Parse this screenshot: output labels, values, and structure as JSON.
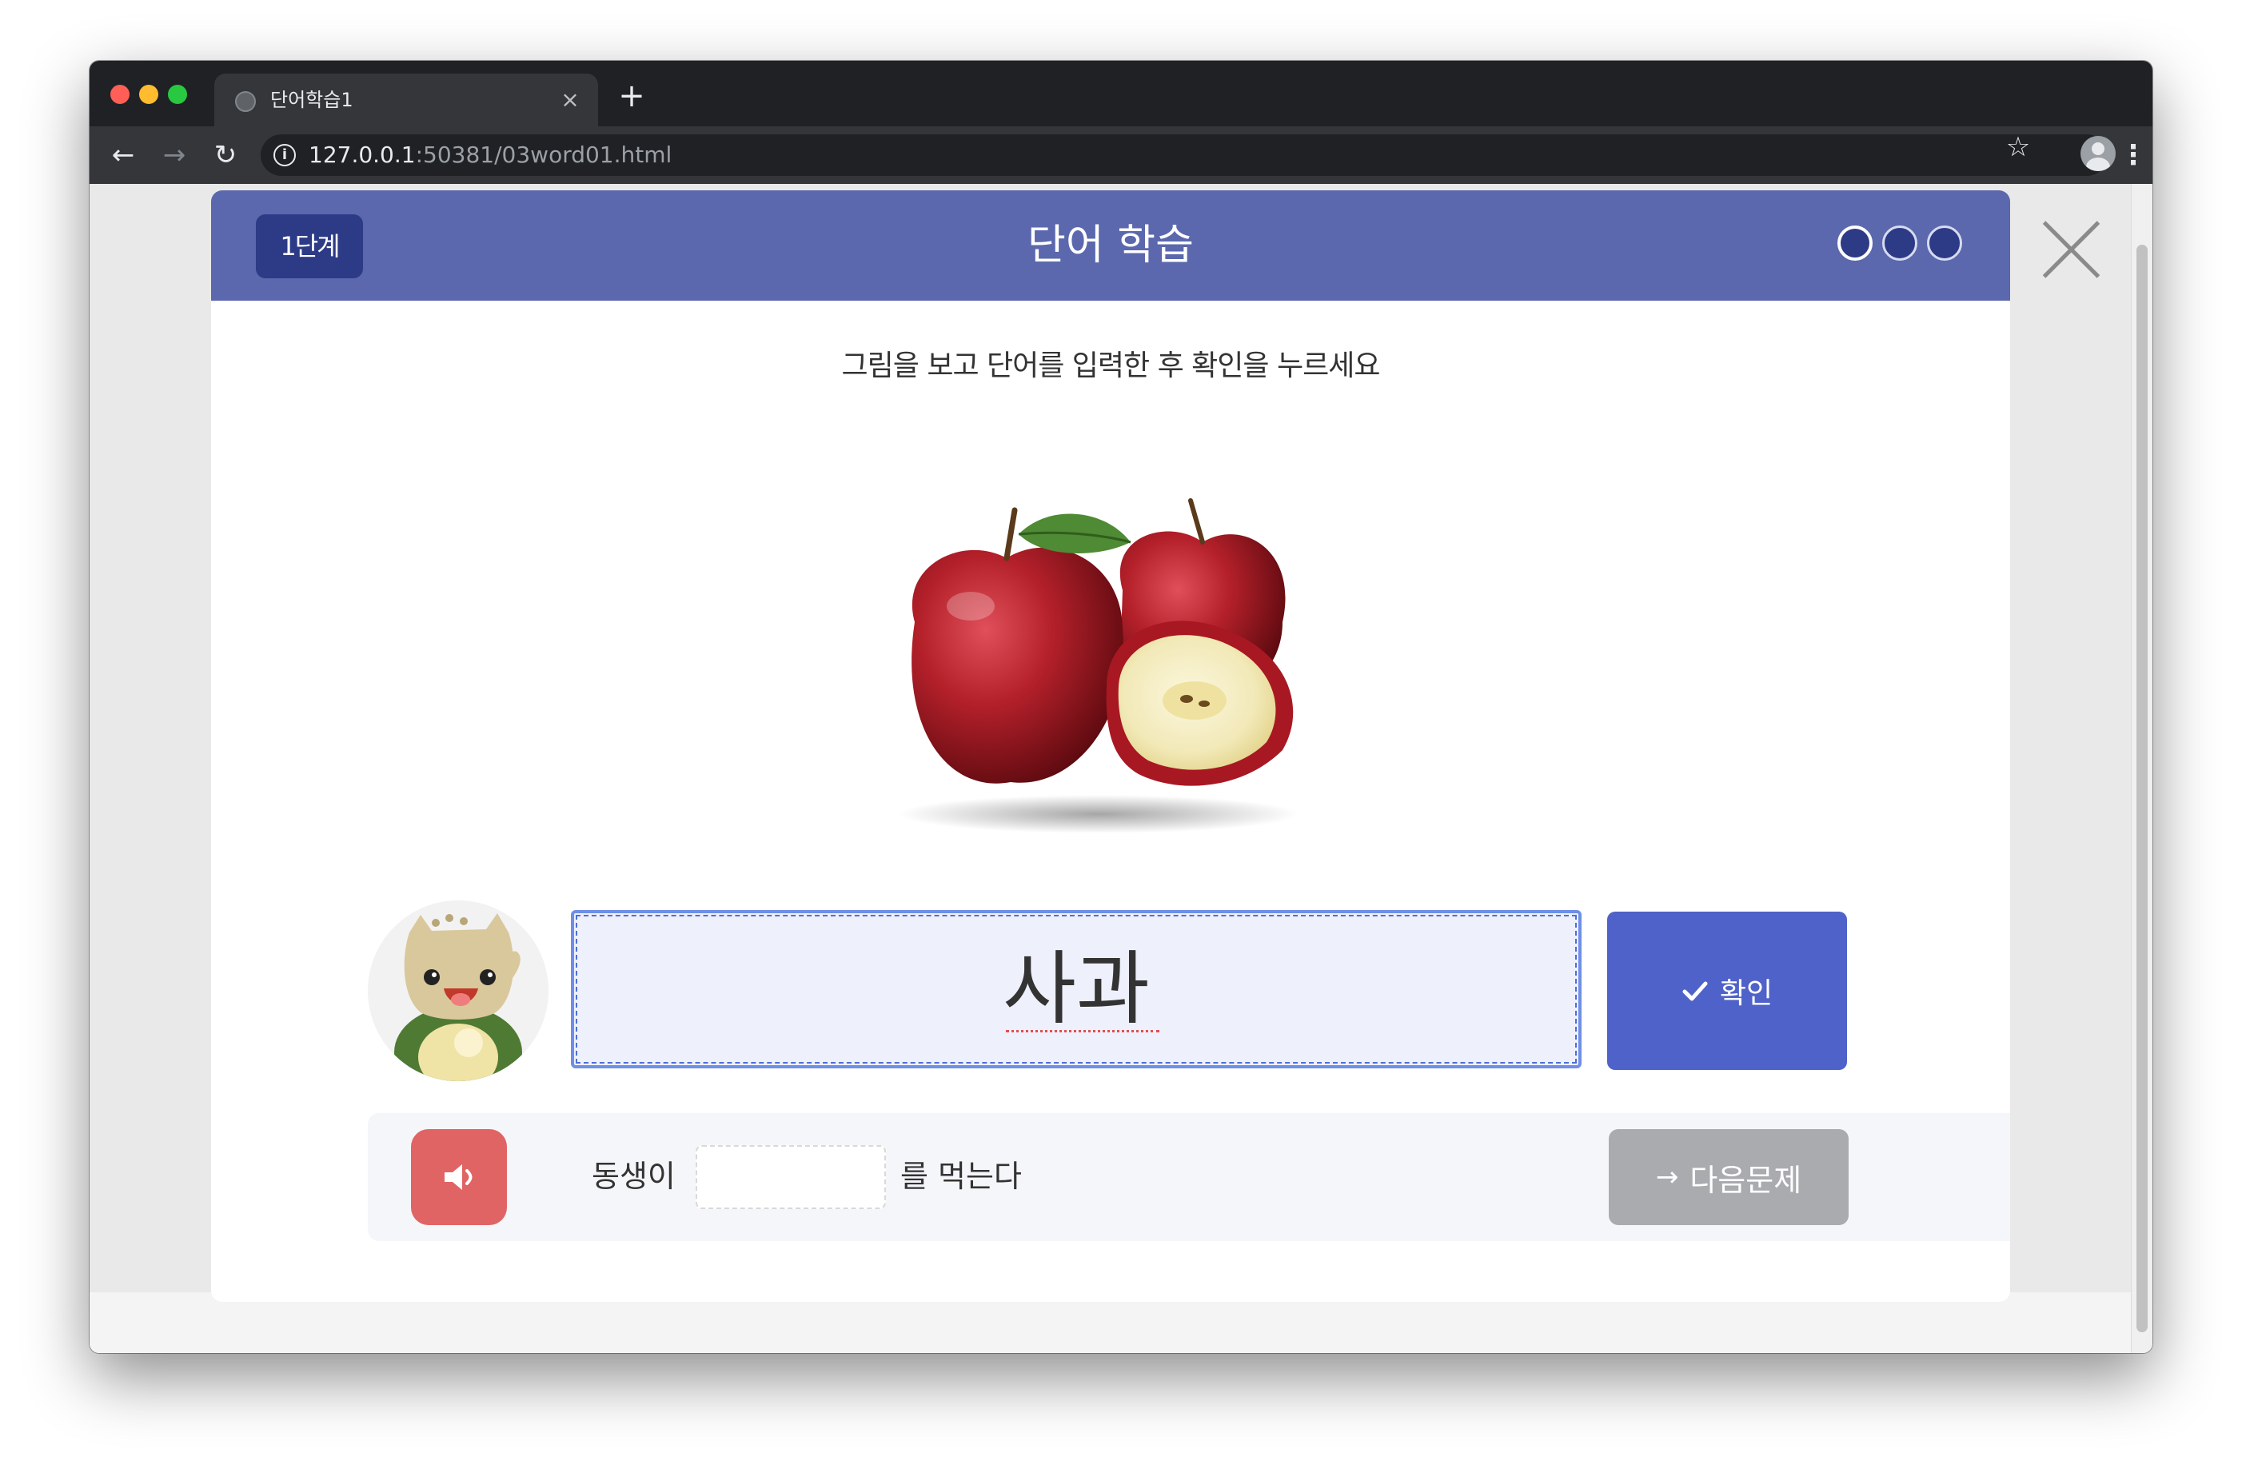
{
  "browser": {
    "tab_title": "단어학습1",
    "tab_close": "×",
    "new_tab": "+",
    "url_host": "127.0.0.1",
    "url_rest": ":50381/03word01.html",
    "icons": [
      "back-arrow-icon",
      "forward-arrow-icon",
      "reload-icon",
      "info-icon",
      "star-icon",
      "profile-icon",
      "menu-icon"
    ]
  },
  "modal": {
    "level": "1단계",
    "title": "단어 학습",
    "progress": {
      "total": 3,
      "current": 1
    },
    "instruction": "그림을 보고 단어를 입력한 후 확인을 누르세요",
    "picture": "apples",
    "answer_value": "사과",
    "confirm_label": "확인",
    "sentence_before": "동생이",
    "sentence_after": "를 먹는다",
    "blank_value": "",
    "next_label": "다음문제"
  },
  "colors": {
    "header": "#5b68ad",
    "badge": "#2d3a86",
    "confirm": "#4f62c9",
    "audio": "#e06464",
    "next_disabled": "#a9abaf"
  }
}
